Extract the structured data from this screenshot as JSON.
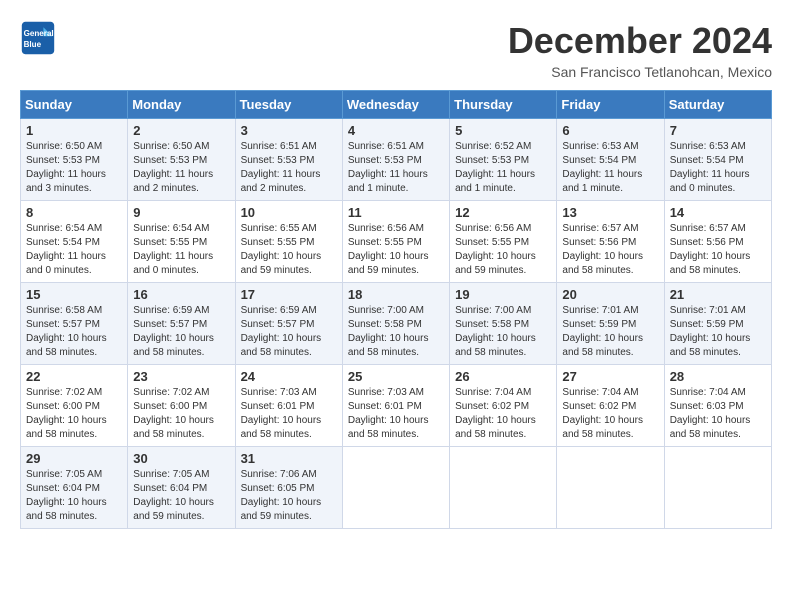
{
  "logo": {
    "line1": "General",
    "line2": "Blue"
  },
  "title": "December 2024",
  "location": "San Francisco Tetlanohcan, Mexico",
  "days_of_week": [
    "Sunday",
    "Monday",
    "Tuesday",
    "Wednesday",
    "Thursday",
    "Friday",
    "Saturday"
  ],
  "weeks": [
    [
      {
        "num": "1",
        "sunrise": "6:50 AM",
        "sunset": "5:53 PM",
        "daylight": "11 hours and 3 minutes."
      },
      {
        "num": "2",
        "sunrise": "6:50 AM",
        "sunset": "5:53 PM",
        "daylight": "11 hours and 2 minutes."
      },
      {
        "num": "3",
        "sunrise": "6:51 AM",
        "sunset": "5:53 PM",
        "daylight": "11 hours and 2 minutes."
      },
      {
        "num": "4",
        "sunrise": "6:51 AM",
        "sunset": "5:53 PM",
        "daylight": "11 hours and 1 minute."
      },
      {
        "num": "5",
        "sunrise": "6:52 AM",
        "sunset": "5:53 PM",
        "daylight": "11 hours and 1 minute."
      },
      {
        "num": "6",
        "sunrise": "6:53 AM",
        "sunset": "5:54 PM",
        "daylight": "11 hours and 1 minute."
      },
      {
        "num": "7",
        "sunrise": "6:53 AM",
        "sunset": "5:54 PM",
        "daylight": "11 hours and 0 minutes."
      }
    ],
    [
      {
        "num": "8",
        "sunrise": "6:54 AM",
        "sunset": "5:54 PM",
        "daylight": "11 hours and 0 minutes."
      },
      {
        "num": "9",
        "sunrise": "6:54 AM",
        "sunset": "5:55 PM",
        "daylight": "11 hours and 0 minutes."
      },
      {
        "num": "10",
        "sunrise": "6:55 AM",
        "sunset": "5:55 PM",
        "daylight": "10 hours and 59 minutes."
      },
      {
        "num": "11",
        "sunrise": "6:56 AM",
        "sunset": "5:55 PM",
        "daylight": "10 hours and 59 minutes."
      },
      {
        "num": "12",
        "sunrise": "6:56 AM",
        "sunset": "5:55 PM",
        "daylight": "10 hours and 59 minutes."
      },
      {
        "num": "13",
        "sunrise": "6:57 AM",
        "sunset": "5:56 PM",
        "daylight": "10 hours and 58 minutes."
      },
      {
        "num": "14",
        "sunrise": "6:57 AM",
        "sunset": "5:56 PM",
        "daylight": "10 hours and 58 minutes."
      }
    ],
    [
      {
        "num": "15",
        "sunrise": "6:58 AM",
        "sunset": "5:57 PM",
        "daylight": "10 hours and 58 minutes."
      },
      {
        "num": "16",
        "sunrise": "6:59 AM",
        "sunset": "5:57 PM",
        "daylight": "10 hours and 58 minutes."
      },
      {
        "num": "17",
        "sunrise": "6:59 AM",
        "sunset": "5:57 PM",
        "daylight": "10 hours and 58 minutes."
      },
      {
        "num": "18",
        "sunrise": "7:00 AM",
        "sunset": "5:58 PM",
        "daylight": "10 hours and 58 minutes."
      },
      {
        "num": "19",
        "sunrise": "7:00 AM",
        "sunset": "5:58 PM",
        "daylight": "10 hours and 58 minutes."
      },
      {
        "num": "20",
        "sunrise": "7:01 AM",
        "sunset": "5:59 PM",
        "daylight": "10 hours and 58 minutes."
      },
      {
        "num": "21",
        "sunrise": "7:01 AM",
        "sunset": "5:59 PM",
        "daylight": "10 hours and 58 minutes."
      }
    ],
    [
      {
        "num": "22",
        "sunrise": "7:02 AM",
        "sunset": "6:00 PM",
        "daylight": "10 hours and 58 minutes."
      },
      {
        "num": "23",
        "sunrise": "7:02 AM",
        "sunset": "6:00 PM",
        "daylight": "10 hours and 58 minutes."
      },
      {
        "num": "24",
        "sunrise": "7:03 AM",
        "sunset": "6:01 PM",
        "daylight": "10 hours and 58 minutes."
      },
      {
        "num": "25",
        "sunrise": "7:03 AM",
        "sunset": "6:01 PM",
        "daylight": "10 hours and 58 minutes."
      },
      {
        "num": "26",
        "sunrise": "7:04 AM",
        "sunset": "6:02 PM",
        "daylight": "10 hours and 58 minutes."
      },
      {
        "num": "27",
        "sunrise": "7:04 AM",
        "sunset": "6:02 PM",
        "daylight": "10 hours and 58 minutes."
      },
      {
        "num": "28",
        "sunrise": "7:04 AM",
        "sunset": "6:03 PM",
        "daylight": "10 hours and 58 minutes."
      }
    ],
    [
      {
        "num": "29",
        "sunrise": "7:05 AM",
        "sunset": "6:04 PM",
        "daylight": "10 hours and 58 minutes."
      },
      {
        "num": "30",
        "sunrise": "7:05 AM",
        "sunset": "6:04 PM",
        "daylight": "10 hours and 59 minutes."
      },
      {
        "num": "31",
        "sunrise": "7:06 AM",
        "sunset": "6:05 PM",
        "daylight": "10 hours and 59 minutes."
      },
      null,
      null,
      null,
      null
    ]
  ]
}
